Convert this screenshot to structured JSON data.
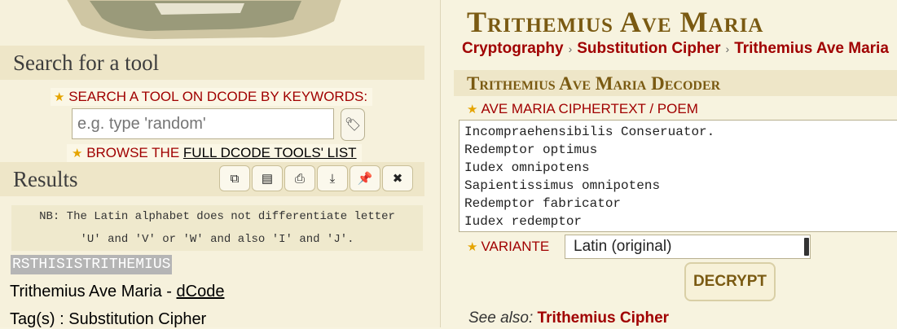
{
  "left": {
    "search_heading": "Search for a tool",
    "search_label": "SEARCH A TOOL ON DCODE BY KEYWORDS:",
    "search_placeholder": "e.g. type 'random'",
    "browse_prefix": "BROWSE THE",
    "browse_link": "FULL DCODE TOOLS' LIST",
    "results_heading": "Results",
    "toolbar_icons": [
      "copy-icon",
      "notes-icon",
      "print-icon",
      "download-icon",
      "pin-icon",
      "close-icon"
    ],
    "nb_line1": "NB: The Latin alphabet does not differentiate letter",
    "nb_line2": "'U' and 'V' or 'W' and also 'I' and 'J'.",
    "result_text": "RSTHISISTRITHEMIUS",
    "result_title_prefix": "Trithemius Ave Maria - ",
    "result_title_link": "dCode",
    "tags": "Tag(s) : Substitution Cipher"
  },
  "right": {
    "title": "Trithemius Ave Maria",
    "breadcrumbs": [
      "Cryptography",
      "Substitution Cipher",
      "Trithemius Ave Maria"
    ],
    "decoder_heading": "Trithemius Ave Maria Decoder",
    "cipher_label": "AVE MARIA CIPHERTEXT / POEM",
    "cipher_lines": [
      "Incompraehensibilis Conseruator.",
      "Redemptor optimus",
      "Iudex omnipotens",
      "Sapientissimus omnipotens",
      "Redemptor fabricator",
      "Iudex redemptor"
    ],
    "variant_label": "VARIANTE",
    "variant_value": "Latin (original)",
    "decrypt_label": "DECRYPT",
    "see_also_label": "See also:",
    "see_also_link": "Trithemius Cipher"
  },
  "colors": {
    "accent_red": "#a00000",
    "title_brown": "#7a5a12",
    "panel_bg": "#f6f1dc",
    "heading_bg": "#eee6c8"
  }
}
